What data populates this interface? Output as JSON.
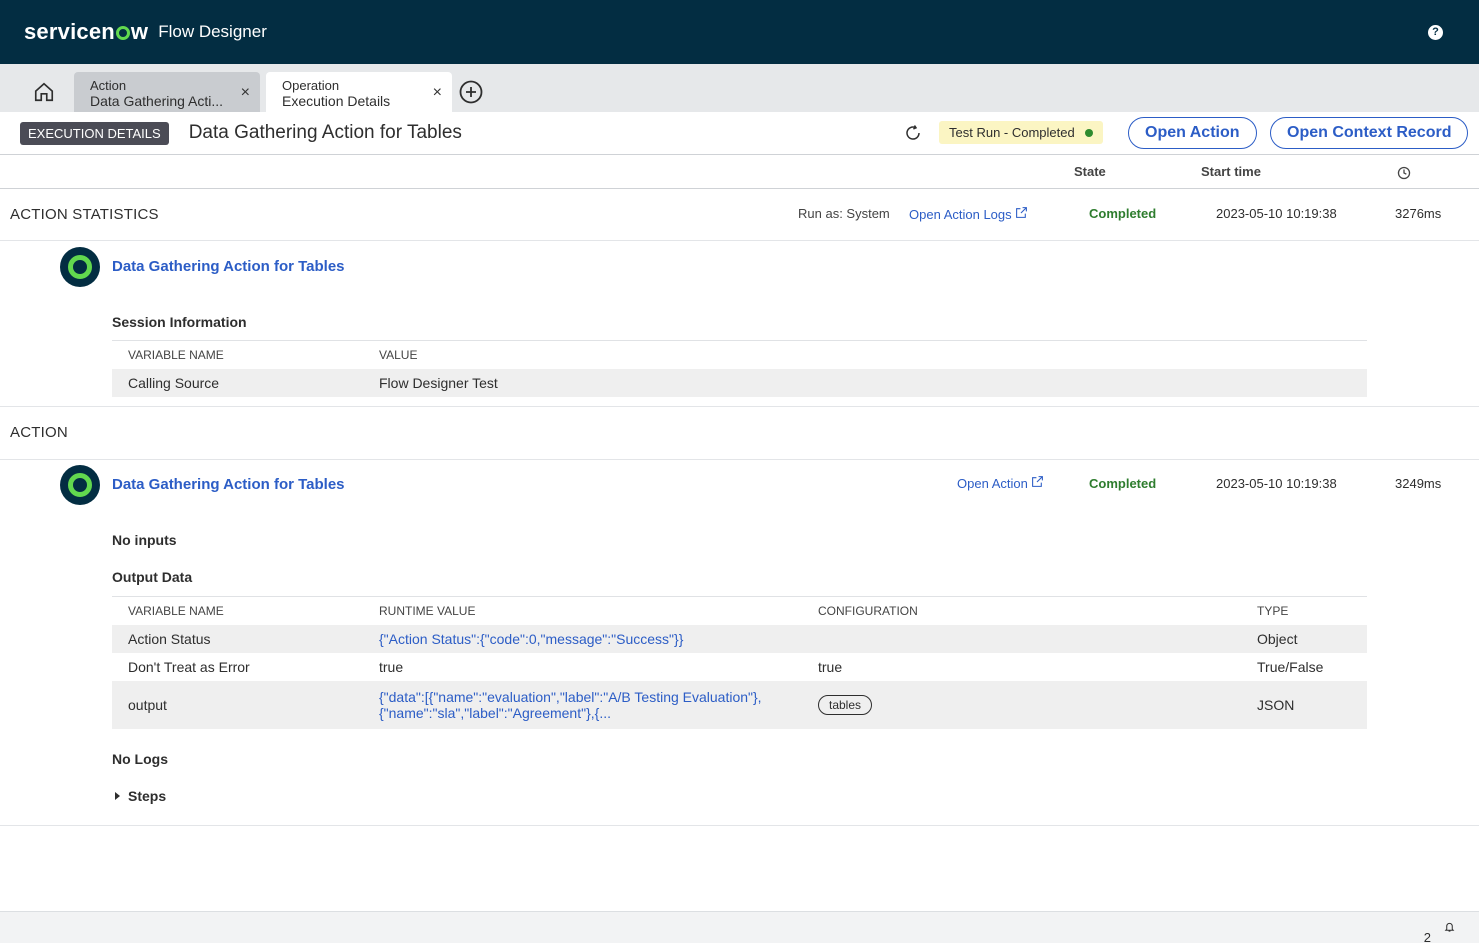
{
  "topbar": {
    "logo_pre": "servicen",
    "logo_post": "w",
    "app_title": "Flow Designer",
    "help": "?"
  },
  "tabs": [
    {
      "title": "Action",
      "subtitle": "Data Gathering Acti...",
      "close": "×"
    },
    {
      "title": "Operation",
      "subtitle": "Execution Details",
      "close": "×"
    }
  ],
  "header": {
    "badge": "EXECUTION DETAILS",
    "title": "Data Gathering Action for Tables",
    "status": "Test Run - Completed",
    "open_action": "Open Action",
    "open_context": "Open Context Record"
  },
  "columns": {
    "state": "State",
    "start_time": "Start time"
  },
  "action_statistics": {
    "title": "ACTION STATISTICS",
    "run_as": "Run as: System",
    "logs_link": "Open Action Logs",
    "state": "Completed",
    "start": "2023-05-10 10:19:38",
    "duration": "3276ms",
    "item_title": "Data Gathering Action for Tables",
    "session_label": "Session Information",
    "session_table": {
      "headers": [
        "VARIABLE NAME",
        "VALUE"
      ],
      "rows": [
        [
          "Calling Source",
          "Flow Designer Test"
        ]
      ]
    }
  },
  "action": {
    "title": "ACTION",
    "item_title": "Data Gathering Action for Tables",
    "open_link": "Open Action",
    "state": "Completed",
    "start": "2023-05-10 10:19:38",
    "duration": "3249ms",
    "no_inputs": "No inputs",
    "output_label": "Output Data",
    "output_table": {
      "headers": [
        "VARIABLE NAME",
        "RUNTIME VALUE",
        "CONFIGURATION",
        "TYPE"
      ],
      "rows": [
        {
          "name": "Action Status",
          "value": "{\"Action Status\":{\"code\":0,\"message\":\"Success\"}}",
          "config": "",
          "type": "Object"
        },
        {
          "name": "Don't Treat as Error",
          "value": "true",
          "config": "true",
          "type": "True/False"
        },
        {
          "name": "output",
          "value1": "{\"data\":[{\"name\":\"evaluation\",\"label\":\"A/B Testing Evaluation\"},",
          "value2": "{\"name\":\"sla\",\"label\":\"Agreement\"},{...",
          "config": "tables",
          "type": "JSON"
        }
      ]
    },
    "no_logs": "No Logs",
    "steps": "Steps"
  },
  "footer": {
    "count": "2"
  },
  "colors": {
    "topbar": "#032d42",
    "brand_green": "#62d84e",
    "link": "#2c5dc6",
    "completed": "#2e7d2e",
    "testrun_bg": "#fbf5c3"
  }
}
